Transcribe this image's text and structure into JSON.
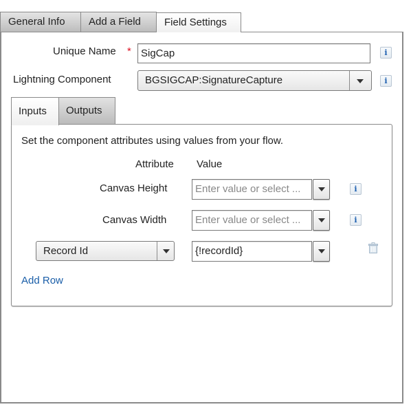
{
  "tabs": [
    {
      "label": "General Info",
      "active": false
    },
    {
      "label": "Add a Field",
      "active": false
    },
    {
      "label": "Field Settings",
      "active": true
    }
  ],
  "form": {
    "unique_name": {
      "label": "Unique Name",
      "required_mark": "*",
      "value": "SigCap"
    },
    "lightning_component": {
      "label": "Lightning Component",
      "value": "BGSIGCAP:SignatureCapture"
    },
    "info_icon_glyph": "i"
  },
  "sub_tabs": [
    {
      "label": "Inputs",
      "active": true
    },
    {
      "label": "Outputs",
      "active": false
    }
  ],
  "inputs_panel": {
    "description": "Set the component attributes using values from your flow.",
    "column_headers": {
      "attribute": "Attribute",
      "value": "Value"
    },
    "rows": [
      {
        "attribute": "Canvas Height",
        "value": "",
        "placeholder": "Enter value or select ...",
        "type": "fixed"
      },
      {
        "attribute": "Canvas Width",
        "value": "",
        "placeholder": "Enter value or select ...",
        "type": "fixed"
      },
      {
        "attribute": "Record Id",
        "value": "{!recordId}",
        "placeholder": "",
        "type": "select"
      }
    ],
    "add_row_label": "Add Row"
  },
  "colors": {
    "link": "#1a5ea8",
    "required": "#dd1122",
    "info_icon": "#1d5fb0",
    "border": "#8a8a8a"
  }
}
